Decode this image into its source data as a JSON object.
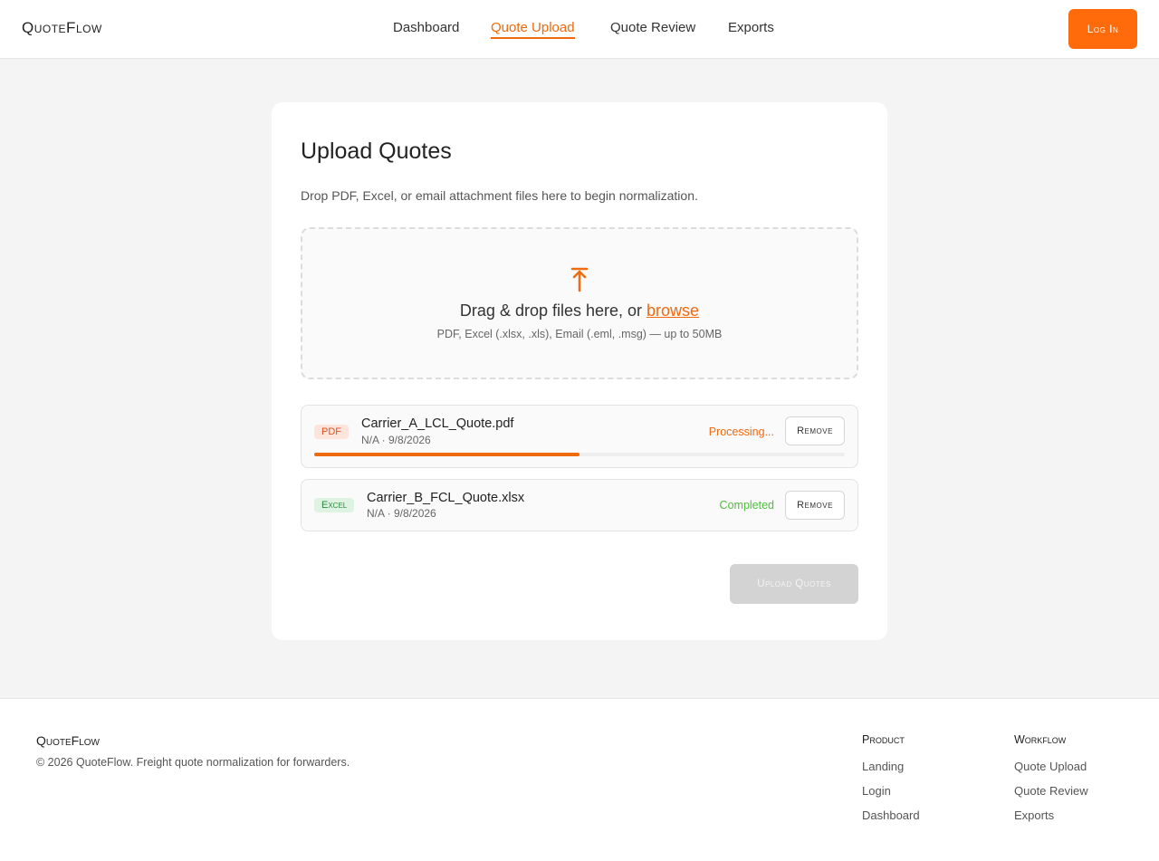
{
  "header": {
    "brand": "QuoteFlow",
    "nav": [
      {
        "label": "Dashboard",
        "active": false
      },
      {
        "label": "Quote Upload",
        "active": true
      },
      {
        "label": "Quote Review",
        "active": false
      },
      {
        "label": "Exports",
        "active": false
      }
    ],
    "login_label": "Log In"
  },
  "upload": {
    "title": "Upload Quotes",
    "subtitle": "Drop PDF, Excel, or email attachment files here to begin normalization.",
    "dropzone": {
      "text": "Drag & drop files here, or",
      "link": "browse",
      "hint": "PDF, Excel (.xlsx, .xls), Email (.eml, .msg) — up to 50MB",
      "icon": "upload-arrow-icon"
    },
    "files": [
      {
        "type": "PDF",
        "name": "Carrier_A_LCL_Quote.pdf",
        "meta": "N/A · 9/8/2026",
        "status": "Processing...",
        "progress": 0.5,
        "remove_label": "Remove"
      },
      {
        "type": "Excel",
        "name": "Carrier_B_FCL_Quote.xlsx",
        "meta": "N/A · 9/8/2026",
        "status": "Completed",
        "remove_label": "Remove"
      }
    ],
    "submit_label": "Upload Quotes"
  },
  "footer": {
    "brand": "QuoteFlow",
    "copyright": "© 2026 QuoteFlow. Freight quote normalization for forwarders.",
    "columns": [
      {
        "title": "Product",
        "links": [
          "Landing",
          "Login",
          "Dashboard"
        ]
      },
      {
        "title": "Workflow",
        "links": [
          "Quote Upload",
          "Quote Review",
          "Exports"
        ]
      }
    ]
  },
  "colors": {
    "accent": "#f06a0f",
    "button": "#ff6b0a",
    "success": "#4fbf3d",
    "disabled": "#d3d3d3"
  }
}
